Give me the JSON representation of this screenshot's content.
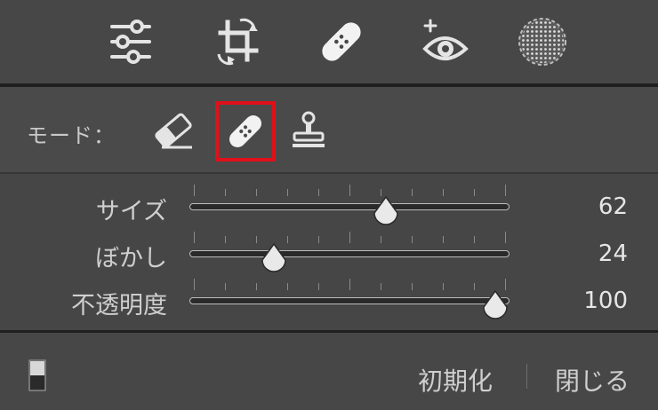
{
  "toolbar": {
    "tools": [
      {
        "name": "adjust-sliders",
        "icon": "sliders-icon"
      },
      {
        "name": "crop-rotate",
        "icon": "crop-icon"
      },
      {
        "name": "healing",
        "icon": "bandage-icon"
      },
      {
        "name": "red-eye",
        "icon": "eye-icon"
      },
      {
        "name": "vignette",
        "icon": "radial-dots-icon"
      }
    ]
  },
  "mode": {
    "label": "モード：",
    "options": [
      {
        "name": "erase",
        "icon": "eraser-icon"
      },
      {
        "name": "heal",
        "icon": "bandage-icon",
        "selected": true
      },
      {
        "name": "clone",
        "icon": "stamp-icon"
      }
    ],
    "highlight_color": "#e0101a"
  },
  "sliders": [
    {
      "label": "サイズ",
      "value": "62",
      "fraction": 0.615
    },
    {
      "label": "ぼかし",
      "value": "24",
      "fraction": 0.265
    },
    {
      "label": "不透明度",
      "value": "100",
      "fraction": 0.955
    }
  ],
  "footer": {
    "reset_label": "初期化",
    "close_label": "閉じる"
  }
}
